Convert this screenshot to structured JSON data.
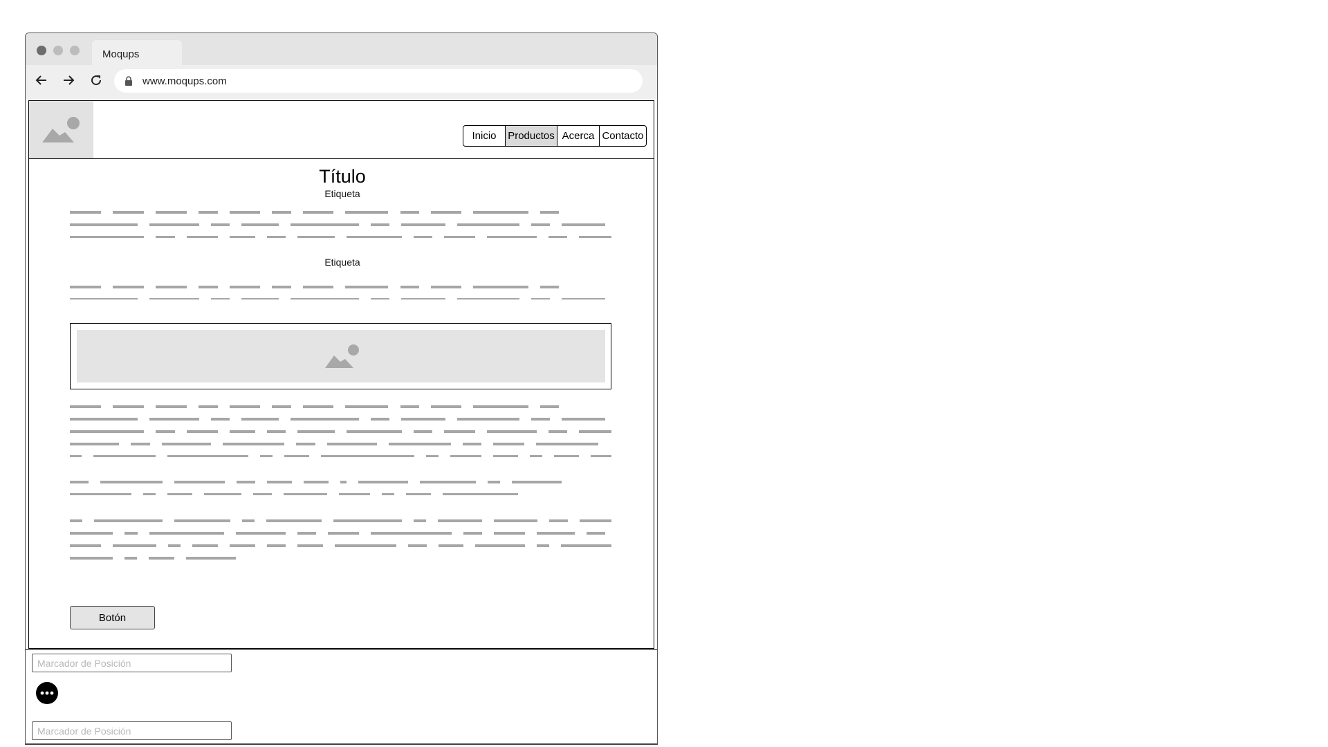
{
  "browser": {
    "tab_title": "Moqups",
    "url": "www.moqups.com"
  },
  "nav": {
    "items": [
      {
        "label": "Inicio",
        "active": false
      },
      {
        "label": "Productos",
        "active": true
      },
      {
        "label": "Acerca",
        "active": false
      },
      {
        "label": "Contacto",
        "active": false
      }
    ]
  },
  "content": {
    "title": "Título",
    "label_1": "Etiqueta",
    "label_2": "Etiqueta",
    "button_label": "Botón"
  },
  "footer_panel": {
    "field_1_placeholder": "Marcador de Posición",
    "field_2_placeholder": "Marcador de Posición"
  },
  "icons": {
    "image_placeholder": "image-placeholder-icon",
    "more": "more-options-icon"
  },
  "colors": {
    "text_placeholder_lines": "#a6a6a6",
    "image_fill": "#e2e2e2",
    "active_tab": "#dadada"
  }
}
